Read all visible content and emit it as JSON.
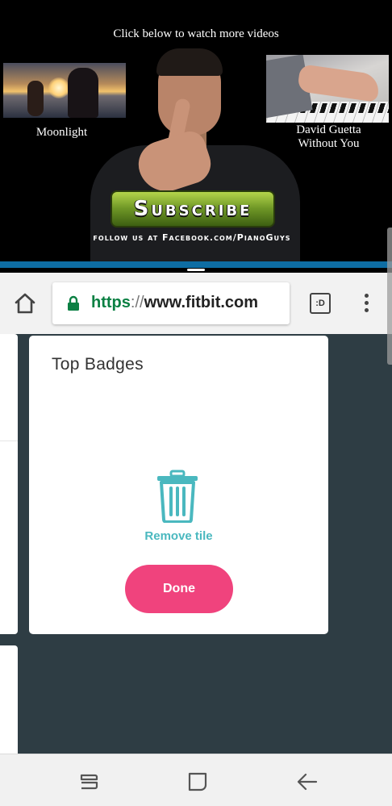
{
  "video": {
    "caption": "Click below to watch more videos",
    "left_video_title": "Moonlight",
    "right_video_title_line1": "David Guetta",
    "right_video_title_line2": "Without You",
    "subscribe_label": "Subscribe",
    "follow_text": "follow us at Facebook.com/PianoGuys"
  },
  "browser": {
    "url_scheme": "https",
    "url_separator": "://",
    "url_host": "www.fitbit.com",
    "tab_switcher_label": ":D",
    "secure": true
  },
  "tile": {
    "title": "Top Badges",
    "remove_label": "Remove tile",
    "done_label": "Done"
  },
  "colors": {
    "accent_teal": "#4ab8bf",
    "done_pink": "#f0437d",
    "page_background": "#2e3d44",
    "split_bar_blue": "#0e6da3",
    "secure_green": "#0b8043"
  },
  "icons": {
    "home": "home-icon",
    "lock": "lock-icon",
    "tabs": "tab-switcher-icon",
    "menu": "overflow-menu-icon",
    "trash": "trash-icon",
    "recent_apps": "recent-apps-icon",
    "home_nav": "home-nav-icon",
    "back": "back-icon"
  }
}
